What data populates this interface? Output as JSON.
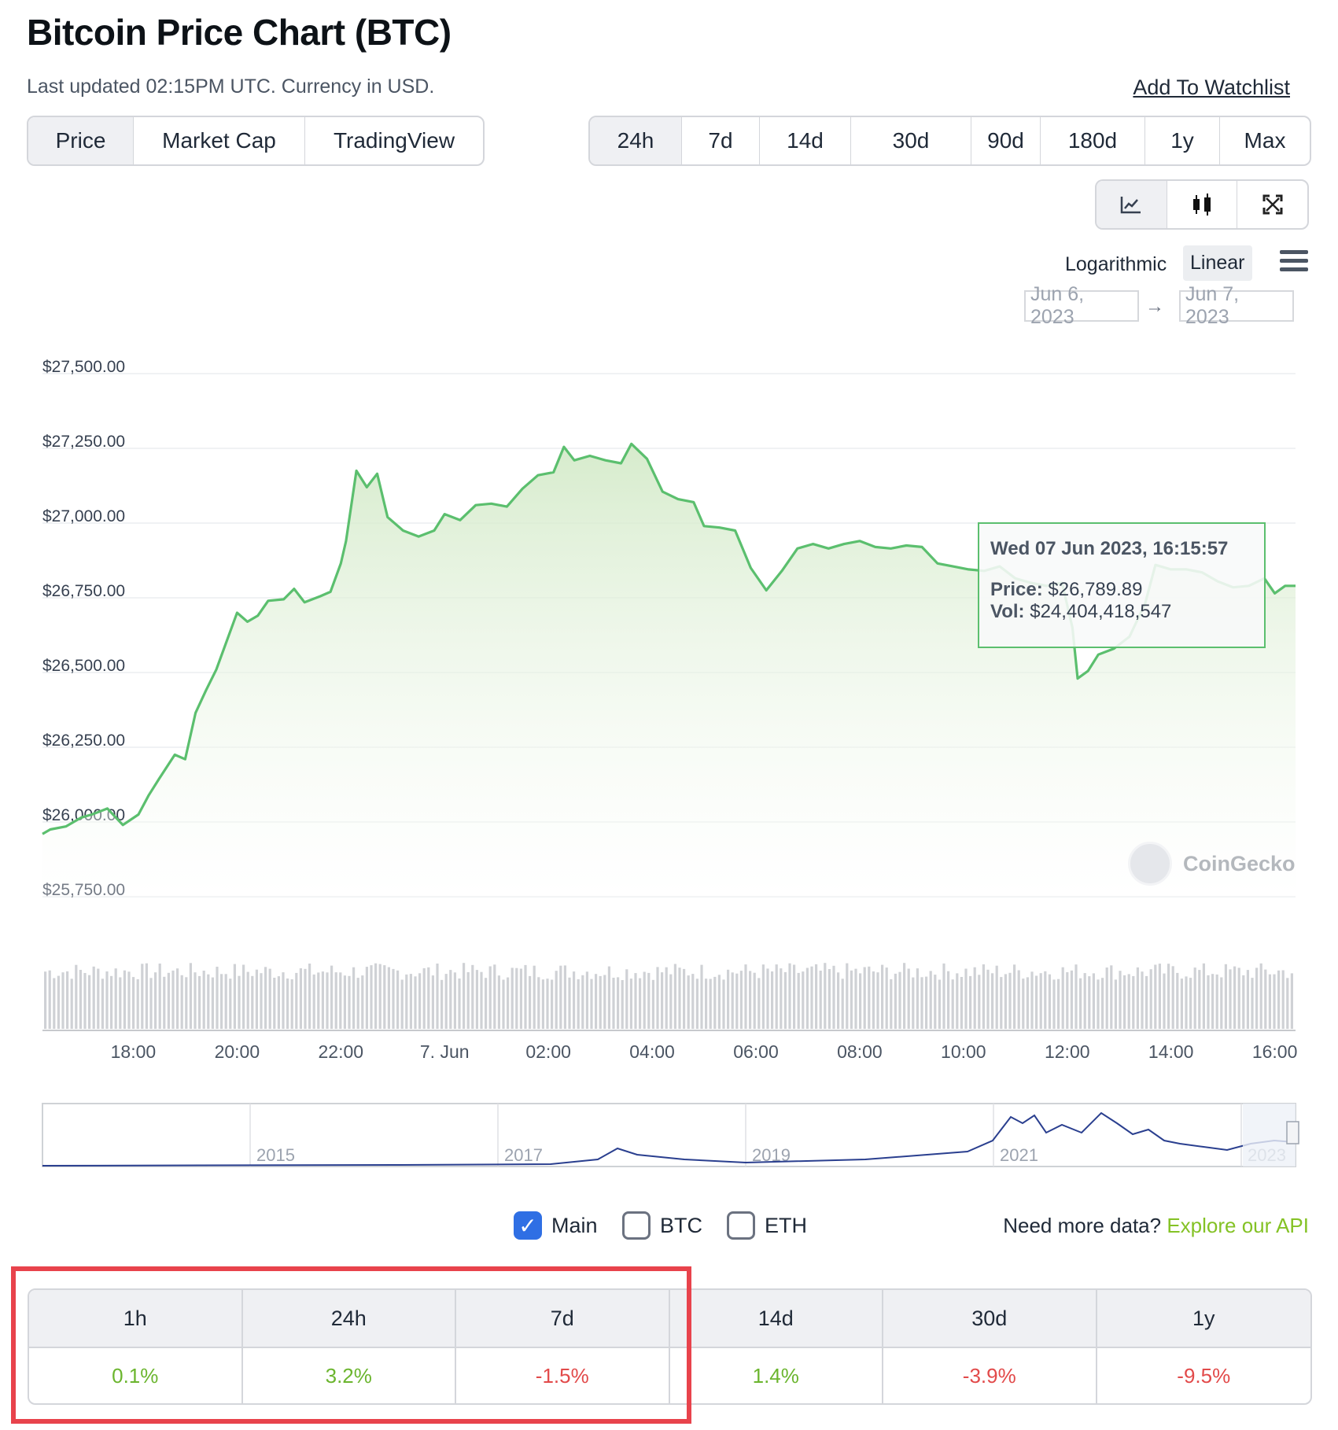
{
  "header": {
    "title": "Bitcoin Price Chart (BTC)",
    "last_updated": "Last updated 02:15PM UTC. Currency in USD.",
    "watchlist_label": "Add To Watchlist"
  },
  "view_tabs": [
    "Price",
    "Market Cap",
    "TradingView"
  ],
  "range_tabs": [
    "24h",
    "7d",
    "14d",
    "30d",
    "90d",
    "180d",
    "1y",
    "Max"
  ],
  "chart_type_icons": [
    "line-chart-icon",
    "candlestick-icon",
    "fullscreen-icon"
  ],
  "scale": {
    "logarithmic": "Logarithmic",
    "linear": "Linear"
  },
  "date_range": {
    "from": "Jun 6, 2023",
    "arrow": "→",
    "to": "Jun 7, 2023"
  },
  "tooltip": {
    "date": "Wed 07 Jun 2023, 16:15:57",
    "price_label": "Price:",
    "price_value": "$26,789.89",
    "vol_label": "Vol:",
    "vol_value": "$24,404,418,547"
  },
  "watermark": "CoinGecko",
  "colors": {
    "line": "#5bbf6e",
    "accent": "#84c225",
    "positive": "#6bb52e",
    "negative": "#e24a4a",
    "highlight": "#e8434c"
  },
  "chart_data": {
    "type": "line",
    "y_ticks": [
      "$27,500.00",
      "$27,250.00",
      "$27,000.00",
      "$26,750.00",
      "$26,500.00",
      "$26,250.00",
      "$26,000.00",
      "$25,750.00"
    ],
    "ylim": [
      25750,
      27500
    ],
    "x_ticks": [
      "18:00",
      "20:00",
      "22:00",
      "7. Jun",
      "02:00",
      "04:00",
      "06:00",
      "08:00",
      "10:00",
      "12:00",
      "14:00",
      "16:00"
    ],
    "x_tick_hours": [
      18,
      20,
      22,
      24,
      26,
      28,
      30,
      32,
      34,
      36,
      38,
      40
    ],
    "xlim_hours": [
      16.25,
      40.4
    ],
    "price_series": [
      [
        16.25,
        25960
      ],
      [
        16.4,
        25975
      ],
      [
        16.7,
        25985
      ],
      [
        17.0,
        26015
      ],
      [
        17.2,
        26025
      ],
      [
        17.5,
        26045
      ],
      [
        17.8,
        25990
      ],
      [
        18.1,
        26025
      ],
      [
        18.3,
        26090
      ],
      [
        18.5,
        26145
      ],
      [
        18.8,
        26225
      ],
      [
        19.0,
        26210
      ],
      [
        19.2,
        26365
      ],
      [
        19.4,
        26440
      ],
      [
        19.6,
        26510
      ],
      [
        19.8,
        26605
      ],
      [
        20.0,
        26700
      ],
      [
        20.2,
        26670
      ],
      [
        20.4,
        26690
      ],
      [
        20.6,
        26740
      ],
      [
        20.9,
        26745
      ],
      [
        21.1,
        26780
      ],
      [
        21.3,
        26735
      ],
      [
        21.6,
        26755
      ],
      [
        21.8,
        26770
      ],
      [
        22.0,
        26865
      ],
      [
        22.1,
        26940
      ],
      [
        22.3,
        27175
      ],
      [
        22.5,
        27120
      ],
      [
        22.7,
        27165
      ],
      [
        22.9,
        27020
      ],
      [
        23.2,
        26975
      ],
      [
        23.5,
        26955
      ],
      [
        23.8,
        26975
      ],
      [
        24.0,
        27030
      ],
      [
        24.3,
        27010
      ],
      [
        24.6,
        27060
      ],
      [
        24.9,
        27065
      ],
      [
        25.2,
        27055
      ],
      [
        25.5,
        27115
      ],
      [
        25.8,
        27160
      ],
      [
        26.1,
        27170
      ],
      [
        26.3,
        27255
      ],
      [
        26.5,
        27210
      ],
      [
        26.8,
        27225
      ],
      [
        27.1,
        27210
      ],
      [
        27.4,
        27200
      ],
      [
        27.6,
        27265
      ],
      [
        27.9,
        27215
      ],
      [
        28.2,
        27105
      ],
      [
        28.5,
        27080
      ],
      [
        28.8,
        27070
      ],
      [
        29.0,
        26990
      ],
      [
        29.3,
        26985
      ],
      [
        29.6,
        26975
      ],
      [
        29.9,
        26850
      ],
      [
        30.2,
        26775
      ],
      [
        30.5,
        26840
      ],
      [
        30.8,
        26915
      ],
      [
        31.1,
        26930
      ],
      [
        31.4,
        26915
      ],
      [
        31.7,
        26930
      ],
      [
        32.0,
        26940
      ],
      [
        32.3,
        26920
      ],
      [
        32.6,
        26915
      ],
      [
        32.9,
        26925
      ],
      [
        33.2,
        26920
      ],
      [
        33.5,
        26865
      ],
      [
        33.8,
        26855
      ],
      [
        34.1,
        26845
      ],
      [
        34.4,
        26840
      ],
      [
        34.7,
        26855
      ],
      [
        35.0,
        26815
      ],
      [
        35.3,
        26800
      ],
      [
        35.6,
        26790
      ],
      [
        35.9,
        26800
      ],
      [
        36.1,
        26650
      ],
      [
        36.2,
        26480
      ],
      [
        36.4,
        26505
      ],
      [
        36.6,
        26560
      ],
      [
        36.9,
        26580
      ],
      [
        37.2,
        26620
      ],
      [
        37.5,
        26730
      ],
      [
        37.7,
        26860
      ],
      [
        38.0,
        26845
      ],
      [
        38.3,
        26845
      ],
      [
        38.6,
        26835
      ],
      [
        38.9,
        26805
      ],
      [
        39.2,
        26785
      ],
      [
        39.5,
        26790
      ],
      [
        39.8,
        26815
      ],
      [
        40.0,
        26765
      ],
      [
        40.2,
        26790
      ],
      [
        40.4,
        26790
      ]
    ],
    "navigator_ticks": [
      "2015",
      "2017",
      "2019",
      "2021",
      "2023"
    ]
  },
  "series_toggles": [
    {
      "label": "Main",
      "checked": true
    },
    {
      "label": "BTC",
      "checked": false
    },
    {
      "label": "ETH",
      "checked": false
    }
  ],
  "api_prompt": {
    "text": "Need more data?",
    "link": "Explore our API"
  },
  "performance": {
    "headers": [
      "1h",
      "24h",
      "7d",
      "14d",
      "30d",
      "1y"
    ],
    "values": [
      "0.1%",
      "3.2%",
      "-1.5%",
      "1.4%",
      "-3.9%",
      "-9.5%"
    ]
  }
}
